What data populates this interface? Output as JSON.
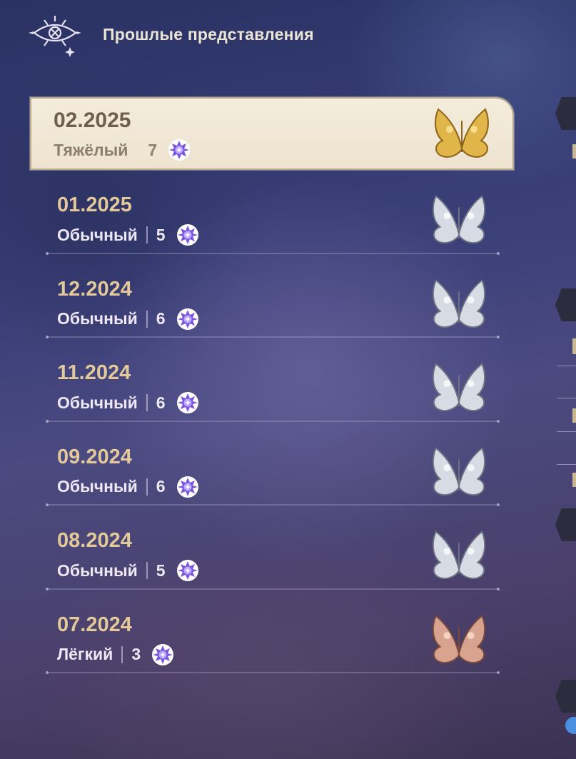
{
  "header": {
    "title": "Прошлые представления",
    "icon": "eye-star-emblem-icon"
  },
  "entries": [
    {
      "date": "02.2025",
      "difficulty": "Тяжёлый",
      "stars": "7",
      "medal": "gold",
      "selected": true
    },
    {
      "date": "01.2025",
      "difficulty": "Обычный",
      "stars": "5",
      "medal": "silver",
      "selected": false
    },
    {
      "date": "12.2024",
      "difficulty": "Обычный",
      "stars": "6",
      "medal": "silver",
      "selected": false
    },
    {
      "date": "11.2024",
      "difficulty": "Обычный",
      "stars": "6",
      "medal": "silver",
      "selected": false
    },
    {
      "date": "09.2024",
      "difficulty": "Обычный",
      "stars": "6",
      "medal": "silver",
      "selected": false
    },
    {
      "date": "08.2024",
      "difficulty": "Обычный",
      "stars": "5",
      "medal": "silver",
      "selected": false
    },
    {
      "date": "07.2024",
      "difficulty": "Лёгкий",
      "stars": "3",
      "medal": "bronze",
      "selected": false
    }
  ],
  "colors": {
    "gold": "#e0b54a",
    "silver": "#d7dbe3",
    "bronze": "#d9a48f",
    "star": "#7d5ce0",
    "date_accent": "#e3c99a"
  }
}
